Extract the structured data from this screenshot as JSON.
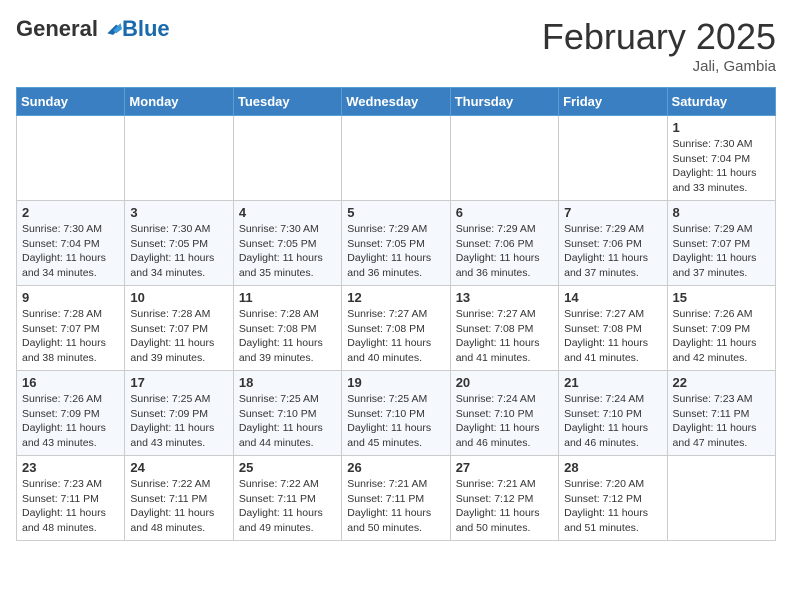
{
  "header": {
    "logo_general": "General",
    "logo_blue": "Blue",
    "month": "February 2025",
    "location": "Jali, Gambia"
  },
  "weekdays": [
    "Sunday",
    "Monday",
    "Tuesday",
    "Wednesday",
    "Thursday",
    "Friday",
    "Saturday"
  ],
  "weeks": [
    [
      {
        "day": "",
        "info": ""
      },
      {
        "day": "",
        "info": ""
      },
      {
        "day": "",
        "info": ""
      },
      {
        "day": "",
        "info": ""
      },
      {
        "day": "",
        "info": ""
      },
      {
        "day": "",
        "info": ""
      },
      {
        "day": "1",
        "info": "Sunrise: 7:30 AM\nSunset: 7:04 PM\nDaylight: 11 hours\nand 33 minutes."
      }
    ],
    [
      {
        "day": "2",
        "info": "Sunrise: 7:30 AM\nSunset: 7:04 PM\nDaylight: 11 hours\nand 34 minutes."
      },
      {
        "day": "3",
        "info": "Sunrise: 7:30 AM\nSunset: 7:05 PM\nDaylight: 11 hours\nand 34 minutes."
      },
      {
        "day": "4",
        "info": "Sunrise: 7:30 AM\nSunset: 7:05 PM\nDaylight: 11 hours\nand 35 minutes."
      },
      {
        "day": "5",
        "info": "Sunrise: 7:29 AM\nSunset: 7:05 PM\nDaylight: 11 hours\nand 36 minutes."
      },
      {
        "day": "6",
        "info": "Sunrise: 7:29 AM\nSunset: 7:06 PM\nDaylight: 11 hours\nand 36 minutes."
      },
      {
        "day": "7",
        "info": "Sunrise: 7:29 AM\nSunset: 7:06 PM\nDaylight: 11 hours\nand 37 minutes."
      },
      {
        "day": "8",
        "info": "Sunrise: 7:29 AM\nSunset: 7:07 PM\nDaylight: 11 hours\nand 37 minutes."
      }
    ],
    [
      {
        "day": "9",
        "info": "Sunrise: 7:28 AM\nSunset: 7:07 PM\nDaylight: 11 hours\nand 38 minutes."
      },
      {
        "day": "10",
        "info": "Sunrise: 7:28 AM\nSunset: 7:07 PM\nDaylight: 11 hours\nand 39 minutes."
      },
      {
        "day": "11",
        "info": "Sunrise: 7:28 AM\nSunset: 7:08 PM\nDaylight: 11 hours\nand 39 minutes."
      },
      {
        "day": "12",
        "info": "Sunrise: 7:27 AM\nSunset: 7:08 PM\nDaylight: 11 hours\nand 40 minutes."
      },
      {
        "day": "13",
        "info": "Sunrise: 7:27 AM\nSunset: 7:08 PM\nDaylight: 11 hours\nand 41 minutes."
      },
      {
        "day": "14",
        "info": "Sunrise: 7:27 AM\nSunset: 7:08 PM\nDaylight: 11 hours\nand 41 minutes."
      },
      {
        "day": "15",
        "info": "Sunrise: 7:26 AM\nSunset: 7:09 PM\nDaylight: 11 hours\nand 42 minutes."
      }
    ],
    [
      {
        "day": "16",
        "info": "Sunrise: 7:26 AM\nSunset: 7:09 PM\nDaylight: 11 hours\nand 43 minutes."
      },
      {
        "day": "17",
        "info": "Sunrise: 7:25 AM\nSunset: 7:09 PM\nDaylight: 11 hours\nand 43 minutes."
      },
      {
        "day": "18",
        "info": "Sunrise: 7:25 AM\nSunset: 7:10 PM\nDaylight: 11 hours\nand 44 minutes."
      },
      {
        "day": "19",
        "info": "Sunrise: 7:25 AM\nSunset: 7:10 PM\nDaylight: 11 hours\nand 45 minutes."
      },
      {
        "day": "20",
        "info": "Sunrise: 7:24 AM\nSunset: 7:10 PM\nDaylight: 11 hours\nand 46 minutes."
      },
      {
        "day": "21",
        "info": "Sunrise: 7:24 AM\nSunset: 7:10 PM\nDaylight: 11 hours\nand 46 minutes."
      },
      {
        "day": "22",
        "info": "Sunrise: 7:23 AM\nSunset: 7:11 PM\nDaylight: 11 hours\nand 47 minutes."
      }
    ],
    [
      {
        "day": "23",
        "info": "Sunrise: 7:23 AM\nSunset: 7:11 PM\nDaylight: 11 hours\nand 48 minutes."
      },
      {
        "day": "24",
        "info": "Sunrise: 7:22 AM\nSunset: 7:11 PM\nDaylight: 11 hours\nand 48 minutes."
      },
      {
        "day": "25",
        "info": "Sunrise: 7:22 AM\nSunset: 7:11 PM\nDaylight: 11 hours\nand 49 minutes."
      },
      {
        "day": "26",
        "info": "Sunrise: 7:21 AM\nSunset: 7:11 PM\nDaylight: 11 hours\nand 50 minutes."
      },
      {
        "day": "27",
        "info": "Sunrise: 7:21 AM\nSunset: 7:12 PM\nDaylight: 11 hours\nand 50 minutes."
      },
      {
        "day": "28",
        "info": "Sunrise: 7:20 AM\nSunset: 7:12 PM\nDaylight: 11 hours\nand 51 minutes."
      },
      {
        "day": "",
        "info": ""
      }
    ]
  ]
}
